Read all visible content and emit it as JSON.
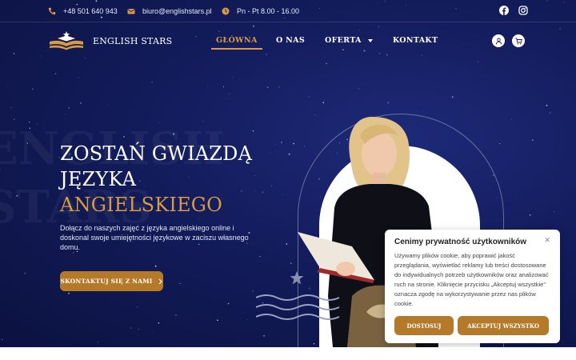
{
  "topbar": {
    "phone": "+48 501 640 943",
    "email": "biuro@englishstars.pl",
    "hours": "Pn - Pt 8.00 - 16.00",
    "social": [
      "facebook-icon",
      "instagram-icon"
    ]
  },
  "brand": {
    "name": "ENGLISH STARS"
  },
  "nav": {
    "items": [
      {
        "label": "GŁÓWNA",
        "active": true
      },
      {
        "label": "O NAS"
      },
      {
        "label": "OFERTA",
        "has_dropdown": true
      },
      {
        "label": "KONTAKT"
      }
    ],
    "icons": [
      "user-icon",
      "cart-icon"
    ]
  },
  "hero": {
    "bg_word_1": "ENGLISH",
    "bg_word_2": "STARS",
    "line1": "ZOSTAŃ GWIAZDĄ",
    "line2": "JĘZYKA",
    "line3": "ANGIELSKIEGO",
    "description": "Dołącz do naszych zajęć z języka angielskiego online i doskonal swoje umiejętności językowe w zaciszu własnego domu.",
    "cta": "SKONTAKTUJ SIĘ Z NAMI"
  },
  "cookie": {
    "title": "Cenimy prywatność użytkowników",
    "text": "Używamy plików cookie, aby poprawić jakość przeglądania, wyświetlać reklamy lub treści dostosowane do indywidualnych potrzeb użytkowników oraz analizować ruch na stronie. Kliknięcie przycisku „Akceptuj wszystkie” oznacza zgodę na wykorzystywanie przez nas plików cookie.",
    "btn_customize": "DOSTOSUJ",
    "btn_accept": "AKCEPTUJ WSZYSTKO"
  },
  "colors": {
    "navy": "#141d5e",
    "gold": "#d89a44",
    "button": "#b5792a"
  }
}
